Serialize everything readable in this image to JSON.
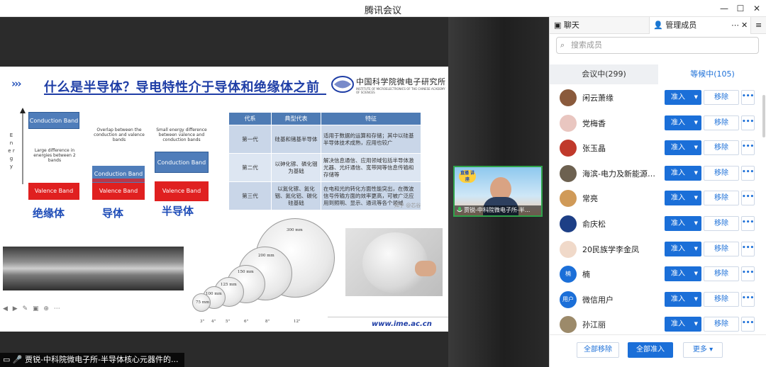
{
  "window": {
    "title": "腾讯会议",
    "min_icon": "minimize-icon",
    "max_icon": "maximize-icon",
    "close_icon": "close-icon"
  },
  "slide": {
    "heading": "什么是半导体？导电特性介于导体和绝缘体之前",
    "arrows": "›››",
    "logo_text": "中国科学院微电子研究所",
    "logo_sub": "INSTITUTE OF MICROELECTRONICS OF THE CHINESE ACADEMY OF SCIENCES",
    "energy_label": "E n e r g y",
    "conduction_band": "Conduction Band",
    "valence_band": "Valence Band",
    "large_gap_note": "Large difference in energies between 2 bands",
    "overlap_note": "Overlap between the conduction and valence bands",
    "small_gap_note": "Small energy difference between valence and conduction bands",
    "insulator": "绝缘体",
    "conductor": "导体",
    "semiconductor": "半导体",
    "table": {
      "headers": [
        "代系",
        "典型代表",
        "特征"
      ],
      "rows": [
        [
          "第一代",
          "硅基和锗基半导体",
          "适用于数据的运算和存储；其中以硅基半导体技术成熟，应用也较广"
        ],
        [
          "第二代",
          "以砷化镓、磷化铟为基础",
          "解决信息通信、应用领域包括半导体激光器、光纤通信、宽带网等信息传输和存储等"
        ],
        [
          "第三代",
          "以氮化镓、氮化铟、氮化铝、碳化硅基础",
          "在电和光的转化方面性能突出，在微波信号传输方面的效率更高，可被广泛应用到照明、显示、通讯等各个领域"
        ]
      ]
    },
    "watermark": "知乎 @芯谷",
    "wafer_sizes": [
      "300 mm",
      "200 mm",
      "150 mm",
      "125 mm",
      "100 mm",
      "75 mm"
    ],
    "wafer_inches": [
      "3\"",
      "4\"",
      "5\"",
      "6\"",
      "8\"",
      "12\""
    ],
    "url": "www.ime.ac.cn",
    "controls": "◀ ▶ ✎ ▣ ⊕ ⋯"
  },
  "speaker": {
    "name": "贾锐-中科院微电子所-半...",
    "banner": "直播 讲座"
  },
  "bottom_name": "贾锐-中科院微电子所-半导体核心元器件的...",
  "panel": {
    "tab_chat": "聊天",
    "tab_members": "管理成员",
    "tab_more": "⋯",
    "tab_close": "✕",
    "menu_icon": "≡",
    "search_placeholder": "搜索成员",
    "in_meeting": "会议中(299)",
    "waiting": "等候中(105)",
    "admit_label": "准入",
    "remove_label": "移除",
    "more_label": "•••",
    "members": [
      {
        "name": "闲云萧缘",
        "color": "#8a5a3c",
        "initial": ""
      },
      {
        "name": "党梅香",
        "color": "#e9c6c0",
        "initial": ""
      },
      {
        "name": "张玉晶",
        "color": "#c0392b",
        "initial": ""
      },
      {
        "name": "海滨-电力及新能源综...",
        "color": "#6d6150",
        "initial": ""
      },
      {
        "name": "常亮",
        "color": "#d09a58",
        "initial": ""
      },
      {
        "name": "俞庆松",
        "color": "#1d3f86",
        "initial": ""
      },
      {
        "name": "20民族学李金凤",
        "color": "#f0d9c9",
        "initial": ""
      },
      {
        "name": "楠",
        "color": "#1b6fd8",
        "initial": "楠"
      },
      {
        "name": "微信用户",
        "color": "#1b6fd8",
        "initial": "用户"
      },
      {
        "name": "孙江丽",
        "color": "#9c8a6a",
        "initial": ""
      }
    ],
    "remove_all": "全部移除",
    "admit_all": "全部准入",
    "more_btn": "更多 ▾"
  }
}
